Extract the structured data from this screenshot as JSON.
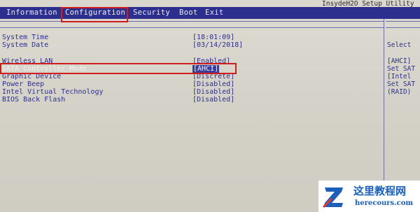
{
  "app": {
    "title": "InsydeH2O Setup Utility"
  },
  "menu": {
    "tabs": [
      {
        "label": "Information"
      },
      {
        "label": "Configuration"
      },
      {
        "label": "Security"
      },
      {
        "label": "Boot"
      },
      {
        "label": "Exit"
      }
    ],
    "active_tab": "Configuration"
  },
  "settings": [
    {
      "label": "System Time",
      "value": "[18:01:09]"
    },
    {
      "label": "System Date",
      "value": "[03/14/2018]"
    },
    {
      "label": "Wireless LAN",
      "value": "[Enabled]"
    },
    {
      "label": "SATA Controller Mode",
      "value": "[AHCI]",
      "selected": true
    },
    {
      "label": "Graphic Device",
      "value": "[Discrete]"
    },
    {
      "label": "Power Beep",
      "value": "[Disabled]"
    },
    {
      "label": "Intel Virtual Technology",
      "value": "[Disabled]"
    },
    {
      "label": "BIOS Back Flash",
      "value": "[Disabled]"
    }
  ],
  "help_panel": {
    "lines": [
      "Select",
      "[AHCI]",
      "Set SAT",
      "[Intel",
      "Set SAT",
      "(RAID)"
    ]
  },
  "watermark": {
    "title": "这里教程网",
    "url": "herecours.com"
  },
  "colors": {
    "menubar": "#2c2f8e",
    "text": "#2d2f8c",
    "highlight": "#d01c1c",
    "background": "#d6d4c8"
  }
}
